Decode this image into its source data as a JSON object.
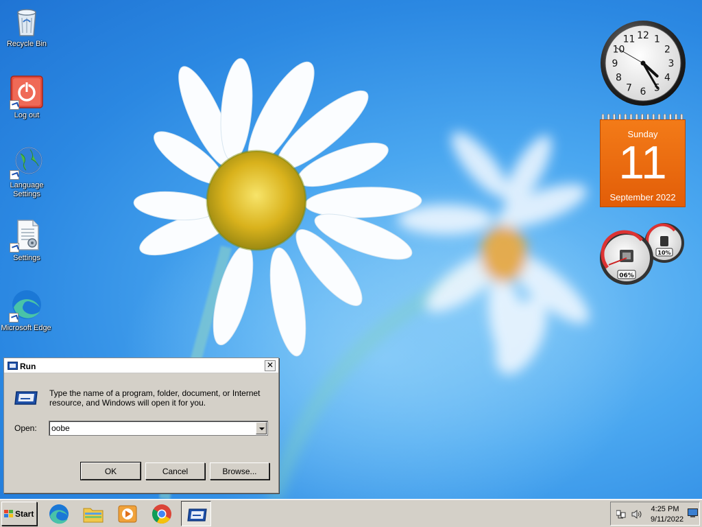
{
  "desktop": {
    "icons": [
      {
        "label": "Recycle Bin",
        "icon": "recycle-bin-icon"
      },
      {
        "label": "Log out",
        "icon": "power-icon"
      },
      {
        "label": "Language Settings",
        "icon": "globe-icon"
      },
      {
        "label": "Settings",
        "icon": "settings-document-icon"
      },
      {
        "label": "Microsoft Edge",
        "icon": "edge-icon"
      }
    ]
  },
  "gadgets": {
    "clock": {
      "numbers": [
        "12",
        "1",
        "2",
        "3",
        "4",
        "5",
        "6",
        "7",
        "8",
        "9",
        "10",
        "11"
      ],
      "hour": 4,
      "minute": 25
    },
    "calendar": {
      "weekday": "Sunday",
      "day": "11",
      "month_year": "September 2022",
      "color": "#f06e12"
    },
    "cpu_meter": {
      "cpu_label": "06%",
      "memory_label": "10%"
    }
  },
  "run_dialog": {
    "title": "Run",
    "description": "Type the name of a program, folder, document, or Internet resource, and Windows will open it for you.",
    "open_label": "Open:",
    "open_value": "oobe",
    "close_glyph": "✕",
    "buttons": {
      "ok": "OK",
      "cancel": "Cancel",
      "browse": "Browse..."
    }
  },
  "taskbar": {
    "start_label": "Start",
    "apps": [
      "Microsoft Edge",
      "File Explorer",
      "Media Player",
      "Google Chrome",
      "Run"
    ],
    "tray": {
      "time": "4:25 PM",
      "date": "9/11/2022"
    }
  },
  "colors": {
    "wallpaper": "#2f8fe8",
    "taskbar": "#d4d0c8",
    "calendar": "#f06e12"
  }
}
